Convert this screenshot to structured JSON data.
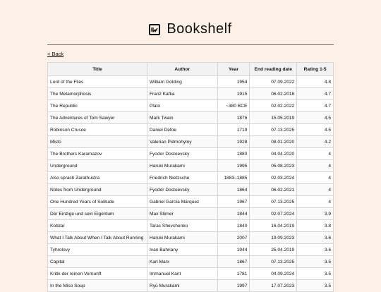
{
  "app": {
    "title": "Bookshelf",
    "logo_icon": "bookshelf-logo-icon"
  },
  "nav": {
    "back_label": "< Back"
  },
  "table": {
    "columns": [
      "Title",
      "Author",
      "Year",
      "End reading date",
      "Rating 1-5"
    ],
    "rows": [
      [
        "Lord of the Flies",
        "William Golding",
        "1954",
        "07.09.2022",
        "4.8"
      ],
      [
        "The Metamorphosis",
        "Franz Kafka",
        "1915",
        "06.02.2018",
        "4.7"
      ],
      [
        "The Republic",
        "Plato",
        "~380 BCE",
        "02.02.2022",
        "4.7"
      ],
      [
        "The Adventures of Tom Sawyer",
        "Mark Twain",
        "1876",
        "15.05.2019",
        "4.5"
      ],
      [
        "Robinson Crusoe",
        "Daniel Defoe",
        "1719",
        "07.13.2025",
        "4.5"
      ],
      [
        "Misto",
        "Valerian Pidmohylny",
        "1928",
        "08.01.2020",
        "4.2"
      ],
      [
        "The Brothers Karamazov",
        "Fyodor Dostoevsky",
        "1880",
        "04.04.2020",
        "4"
      ],
      [
        "Underground",
        "Haruki Murakami",
        "1995",
        "05.08.2023",
        "4"
      ],
      [
        "Also sprach Zarathustra",
        "Friedrich Nietzsche",
        "1883–1885",
        "02.03.2024",
        "4"
      ],
      [
        "Notes from Underground",
        "Fyodor Dostoevsky",
        "1864",
        "06.02.2021",
        "4"
      ],
      [
        "One Hundred Years of Solitude",
        "Gabriel García Márquez",
        "1967",
        "07.13.2025",
        "4"
      ],
      [
        "Der Einzige und sein Eigentum",
        "Max Stirner",
        "1844",
        "02.07.2024",
        "3.9"
      ],
      [
        "Kobzar",
        "Taras Shevchenko",
        "1840",
        "16.04.2019",
        "3.8"
      ],
      [
        "What I Talk About When I Talk About Running",
        "Haruki Murakami",
        "2007",
        "19.09.2023",
        "3.6"
      ],
      [
        "Tyhrolovy",
        "Ivan Bahriany",
        "1944",
        "25.04.2019",
        "3.6"
      ],
      [
        "Capital",
        "Karl Marx",
        "1867",
        "07.13.2025",
        "3.5"
      ],
      [
        "Kritik der reinen Vernunft",
        "Immanuel Kant",
        "1781",
        "04.09.2024",
        "3.5"
      ],
      [
        "In the Miso Soup",
        "Ryū Murakami",
        "1997",
        "17.07.2023",
        "3.5"
      ]
    ]
  }
}
